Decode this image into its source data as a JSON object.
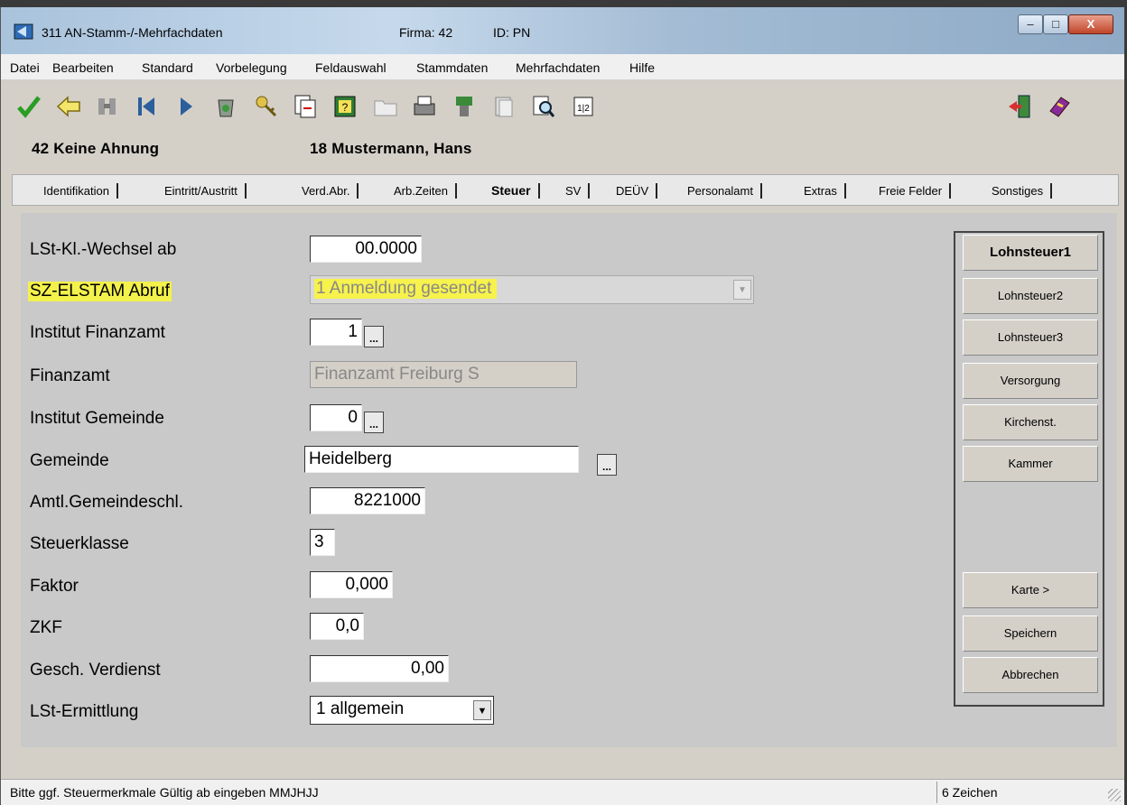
{
  "window": {
    "title": "311 AN-Stamm-/-Mehrfachdaten",
    "firma": "Firma: 42",
    "id": "ID: PN",
    "min": "–",
    "max": "□",
    "close": "X"
  },
  "menu": [
    "Datei",
    "Bearbeiten",
    "Standard",
    "Vorbelegung",
    "Feldauswahl",
    "Stammdaten",
    "Mehrfachdaten",
    "Hilfe"
  ],
  "toolbar": [
    "check-icon",
    "arrow-left-icon",
    "binoculars-icon",
    "first-record-icon",
    "next-record-icon",
    "recycle-icon",
    "key-icon",
    "copy-icon",
    "help-icon",
    "folder-icon",
    "print-icon",
    "stamp-icon",
    "documents-icon",
    "search-icon",
    "calculator-icon",
    "exit-icon",
    "book-icon"
  ],
  "header": {
    "company": "42 Keine Ahnung",
    "employee": "18 Mustermann, Hans"
  },
  "tabs": [
    "Identifikation",
    "Eintritt/Austritt",
    "Verd.Abr.",
    "Arb.Zeiten",
    "Steuer",
    "SV",
    "DEÜV",
    "Personalamt",
    "Extras",
    "Freie Felder",
    "Sonstiges"
  ],
  "active_tab": "Steuer",
  "form": {
    "lst_wechsel_label": "LSt-Kl.-Wechsel ab",
    "lst_wechsel_value": "00.0000",
    "sz_elstam_label": "SZ-ELSTAM Abruf",
    "sz_elstam_value": "1 Anmeldung gesendet",
    "inst_finanzamt_label": "Institut Finanzamt",
    "inst_finanzamt_value": "1",
    "finanzamt_label": "Finanzamt",
    "finanzamt_value": "Finanzamt Freiburg S",
    "inst_gemeinde_label": "Institut Gemeinde",
    "inst_gemeinde_value": "0",
    "gemeinde_label": "Gemeinde",
    "gemeinde_value": "Heidelberg",
    "amtl_label": "Amtl.Gemeindeschl.",
    "amtl_value": "8221000",
    "steuerklasse_label": "Steuerklasse",
    "steuerklasse_value": "3",
    "faktor_label": "Faktor",
    "faktor_value": "0,000",
    "zkf_label": "ZKF",
    "zkf_value": "0,0",
    "gesch_label": "Gesch. Verdienst",
    "gesch_value": "0,00",
    "ermittlung_label": "LSt-Ermittlung",
    "ermittlung_value": "1 allgemein",
    "dots": "..."
  },
  "side_buttons": {
    "lohnsteuer1": "Lohnsteuer1",
    "lohnsteuer2": "Lohnsteuer2",
    "lohnsteuer3": "Lohnsteuer3",
    "versorgung": "Versorgung",
    "kirchenst": "Kirchenst.",
    "kammer": "Kammer",
    "karte": "Karte >",
    "speichern": "Speichern",
    "abbrechen": "Abbrechen"
  },
  "status": {
    "message": "Bitte ggf. Steuermerkmale Gültig ab eingeben MMJHJJ",
    "count": "6 Zeichen"
  }
}
